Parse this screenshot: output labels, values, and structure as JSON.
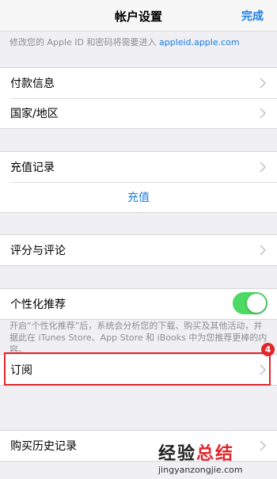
{
  "nav": {
    "title": "帐户设置",
    "done": "完成"
  },
  "apple_id_hint": {
    "prefix": "修改您的 Apple ID 和密码将需要进入 ",
    "link": "appleid.apple.com"
  },
  "groups": {
    "payment": [
      "付款信息",
      "国家/地区"
    ],
    "purchase": {
      "history_label": "充值记录",
      "action_label": "充值"
    },
    "ratings": "评分与评论",
    "personalized": {
      "label": "个性化推荐",
      "enabled": true,
      "footnote": "开启“个性化推荐”后，系统会分析您的下载、购买及其他活动，并据此在 iTunes Store、App Store 和 iBooks 中为您推荐更棒的内容。"
    },
    "subscriptions": "订阅",
    "purchase_history": "购买历史记录"
  },
  "annotation": {
    "step": "4",
    "color": "#e0262b"
  },
  "watermark": {
    "title_a": "经验",
    "title_b": "总结",
    "url": "jingyanzongjie.com"
  },
  "colors": {
    "accent": "#1a7ce0",
    "toggle_on": "#4cd964"
  }
}
